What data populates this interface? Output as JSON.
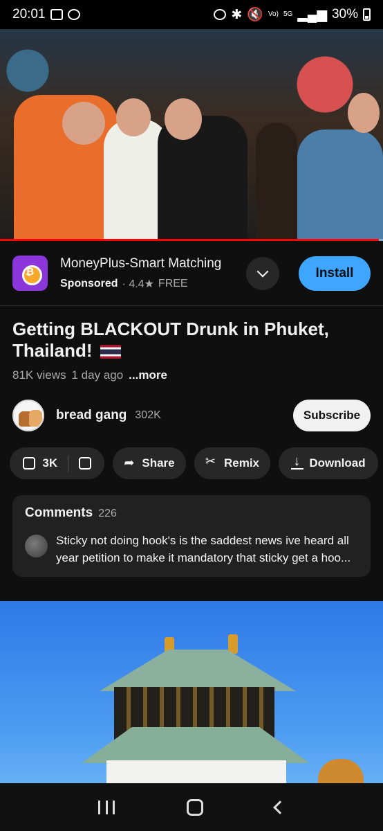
{
  "status_bar": {
    "time": "20:01",
    "network_label": "5G",
    "volte_label": "Vo)",
    "battery": "30%"
  },
  "video": {
    "progress_fraction": 0.99
  },
  "ad": {
    "title": "MoneyPlus-Smart Matching",
    "sponsored": "Sponsored",
    "rating": "· 4.4★",
    "price": "FREE",
    "install_label": "Install"
  },
  "video_info": {
    "title": "Getting BLACKOUT Drunk in Phuket, Thailand!",
    "views": "81K views",
    "age": "1 day ago",
    "more": "...more"
  },
  "channel": {
    "name": "bread gang",
    "subscribers": "302K",
    "subscribe_label": "Subscribe"
  },
  "actions": {
    "like_count": "3K",
    "share": "Share",
    "remix": "Remix",
    "download": "Download"
  },
  "comments": {
    "heading": "Comments",
    "count": "226",
    "top_comment": "Sticky not doing hook's is the saddest news ive heard all year petition to make it mandatory that sticky get a hoo..."
  },
  "icons": {
    "gallery": "gallery-icon",
    "whatsapp": "whatsapp-icon",
    "alarm": "alarm-icon",
    "bluetooth": "bluetooth-icon",
    "mute": "mute-icon"
  },
  "colors": {
    "background": "#0f0f0f",
    "install_button": "#3ea6ff",
    "progress": "#ff0000",
    "ad_logo": "#8a36db"
  }
}
